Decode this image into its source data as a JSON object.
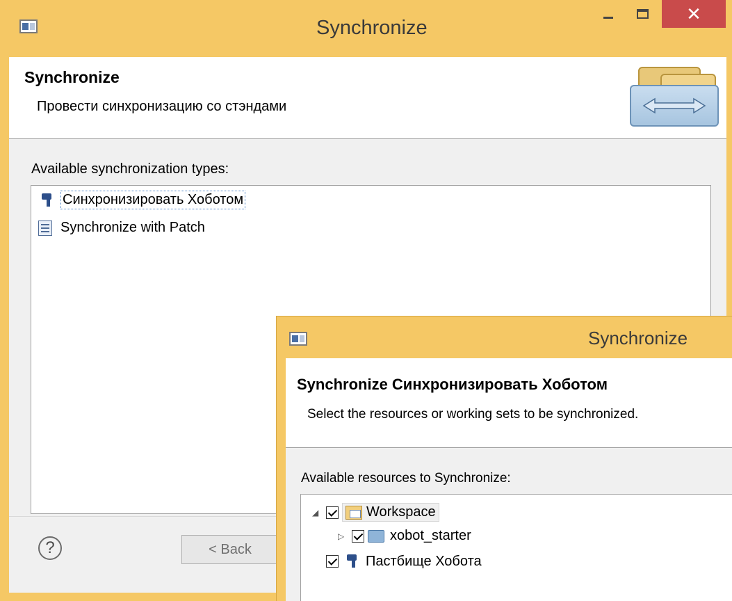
{
  "main_window": {
    "title": "Synchronize",
    "header_title": "Synchronize",
    "header_desc": "Провести синхронизацию со стэндами",
    "list_label": "Available synchronization types:",
    "types": [
      {
        "label": "Синхронизировать Хоботом",
        "icon": "key-icon",
        "selected": true
      },
      {
        "label": "Synchronize with Patch",
        "icon": "patch-icon",
        "selected": false
      }
    ],
    "buttons": {
      "back": "< Back",
      "help": "?"
    }
  },
  "dialog": {
    "title": "Synchronize",
    "header_title": "Synchronize Синхронизировать Хоботом",
    "header_desc": "Select the resources or working sets to be synchronized.",
    "list_label": "Available resources to Synchronize:",
    "tree": [
      {
        "label": "Workspace",
        "checked": true,
        "expanded": true
      },
      {
        "label": "xobot_starter",
        "checked": true,
        "expanded": false
      },
      {
        "label": "Пастбище Хобота",
        "checked": true
      }
    ]
  },
  "colors": {
    "titlebar": "#f5c865",
    "close": "#c94b4b",
    "selection": "#4a82c6"
  }
}
